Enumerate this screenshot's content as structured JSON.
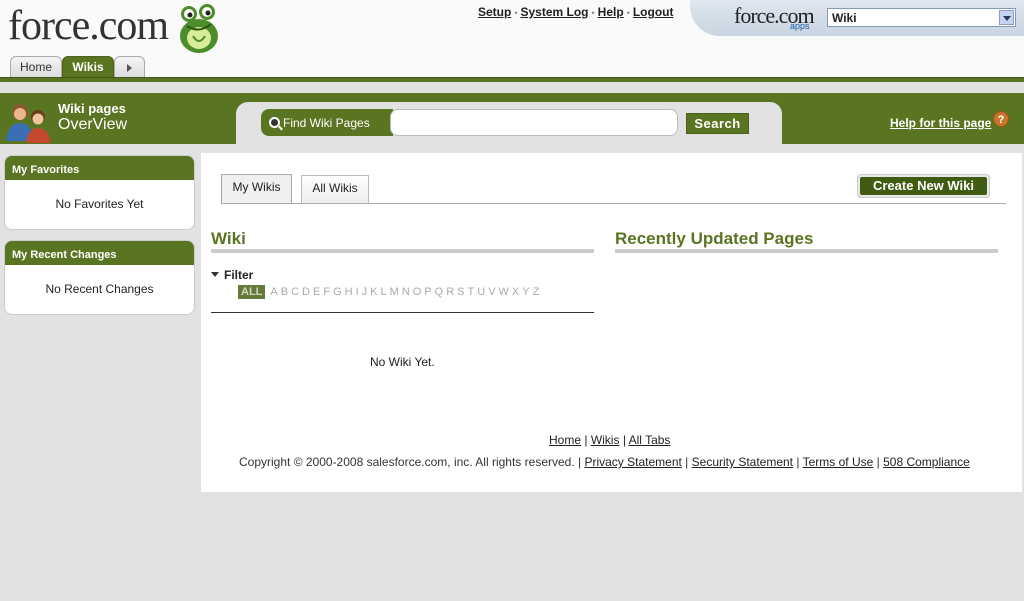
{
  "logo": {
    "text_main": "force",
    "text_dot": ".",
    "text_com": "com"
  },
  "top_links": {
    "setup": "Setup",
    "system_log": "System Log",
    "help": "Help",
    "logout": "Logout",
    "separator": "•"
  },
  "app_picker": {
    "logo_text": "force.com",
    "logo_sub": "apps",
    "selected": "Wiki"
  },
  "tabs": {
    "home": "Home",
    "wikis": "Wikis"
  },
  "header": {
    "title_line1": "Wiki pages",
    "title_line2": "OverView",
    "search_label": "Find Wiki Pages",
    "search_value": "",
    "search_button": "Search",
    "help_link": "Help for this page",
    "help_icon_glyph": "?"
  },
  "sidebar": {
    "favorites": {
      "title": "My Favorites",
      "empty": "No Favorites Yet"
    },
    "recent": {
      "title": "My Recent Changes",
      "empty": "No Recent Changes"
    }
  },
  "main": {
    "subtabs": {
      "my_wikis": "My Wikis",
      "all_wikis": "All Wikis"
    },
    "create_button": "Create New Wiki",
    "wiki_title": "Wiki",
    "recent_title": "Recently Updated Pages",
    "filter_label": "Filter",
    "alphabet": [
      "ALL",
      "A",
      "B",
      "C",
      "D",
      "E",
      "F",
      "G",
      "H",
      "I",
      "J",
      "K",
      "L",
      "M",
      "N",
      "O",
      "P",
      "Q",
      "R",
      "S",
      "T",
      "U",
      "V",
      "W",
      "X",
      "Y",
      "Z"
    ],
    "empty_message": "No Wiki Yet."
  },
  "footer": {
    "links": [
      "Home",
      "Wikis",
      "All Tabs"
    ],
    "copyright": "Copyright © 2000-2008 salesforce.com, inc. All rights reserved. |",
    "legal_links": [
      "Privacy Statement",
      "Security Statement",
      "Terms of Use",
      "508 Compliance"
    ]
  },
  "colors": {
    "brand_green": "#5a7521",
    "dark_green": "#3f5c12"
  }
}
